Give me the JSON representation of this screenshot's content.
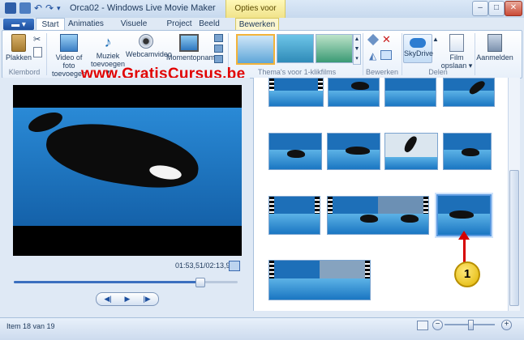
{
  "window": {
    "title": "Orca02 - Windows Live Movie Maker",
    "context_tab_header": "Opties voor video",
    "buttons": {
      "minimize": "–",
      "maximize": "□",
      "close": "✕"
    }
  },
  "tabs": [
    {
      "label": "Start"
    },
    {
      "label": "Animaties"
    },
    {
      "label": "Visuele effecten"
    },
    {
      "label": "Project"
    },
    {
      "label": "Beeld"
    },
    {
      "label": "Bewerken"
    }
  ],
  "ribbon": {
    "clipboard": {
      "paste": "Plakken",
      "group": "Klembord"
    },
    "add": {
      "video_line1": "Video of foto",
      "video_line2": "toevoegen",
      "music_line1": "Muziek",
      "music_line2": "toevoegen ▾",
      "webcam": "Webcamvideo",
      "snapshot": "Momentopname"
    },
    "themes_group": "Thema's voor 1-klikfilms",
    "edit_group": "Bewerken",
    "share": {
      "skydrive": "SkyDrive",
      "save_line1": "Film",
      "save_line2": "opslaan ▾",
      "group": "Delen"
    },
    "signin": "Aanmelden"
  },
  "watermark": "www.GratisCursus.be",
  "player": {
    "time": "01:53,51/02:13,93",
    "progress": 0.83,
    "controls": {
      "prev": "◀|",
      "play": "▶",
      "next": "|▶"
    }
  },
  "callout": {
    "number": "1"
  },
  "status": {
    "item": "Item 18 van 19"
  },
  "zoom": {
    "minus": "−",
    "plus": "+"
  },
  "colors": {
    "accent": "#1d4f9e",
    "context_tab": "#f0e38a",
    "callout": "#e0b400",
    "arrow": "#d60000"
  }
}
